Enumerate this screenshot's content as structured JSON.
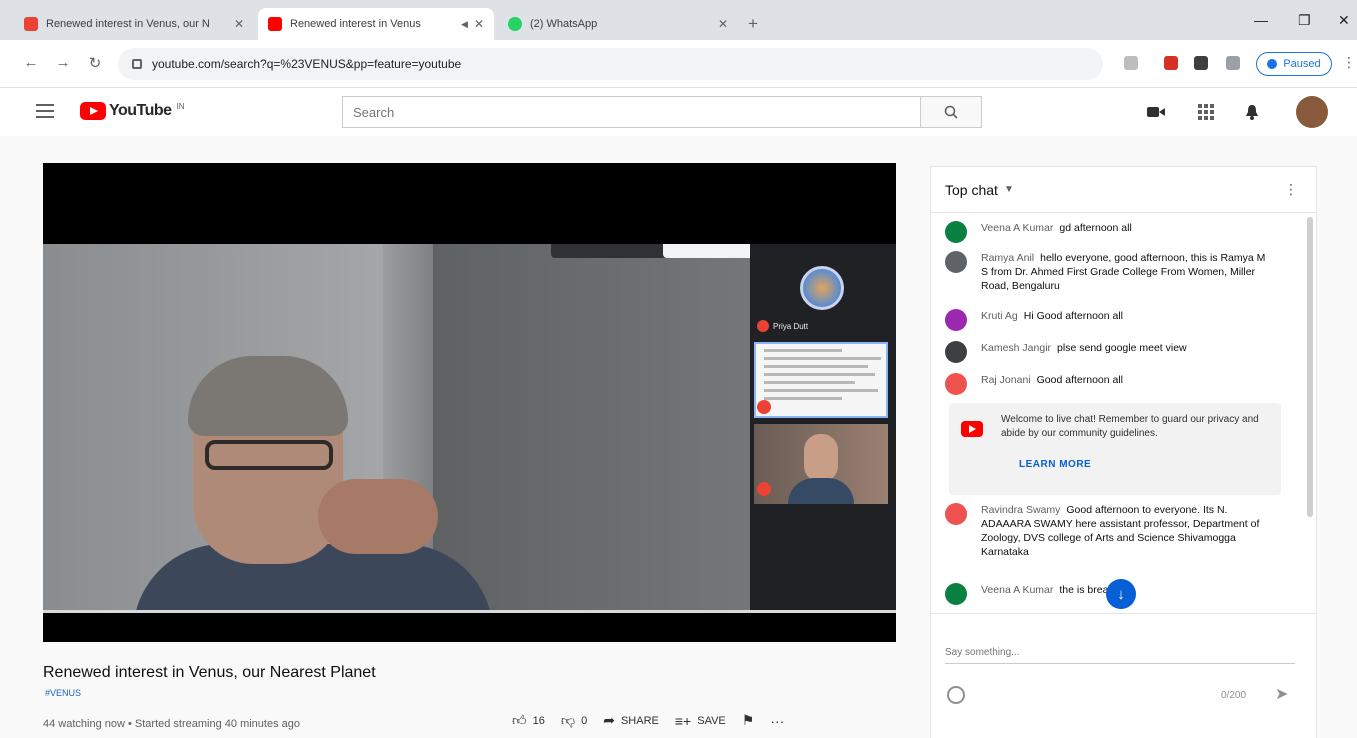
{
  "browser": {
    "tabs": [
      {
        "title": "Renewed interest in Venus, our N",
        "favicon_color": "#ea4335",
        "active": false
      },
      {
        "title": "Renewed interest in Venus",
        "favicon_color": "#ff0000",
        "active": true
      },
      {
        "title": "(2) WhatsApp",
        "favicon_color": "#25d366",
        "active": false
      }
    ],
    "new_tab_icon": "plus-icon",
    "url": "youtube.com/search?q=%23VENUS&pp=feature=youtube",
    "paused_label": "Paused"
  },
  "masthead": {
    "logo_text": "YouTube",
    "region": "IN",
    "search_placeholder": "Search"
  },
  "player": {
    "tile_name": "Priya Dutt",
    "progress": 1.0
  },
  "video": {
    "title": "Renewed interest in Venus, our Nearest Planet",
    "channel_tag": "#VENUS",
    "watch_info": "44 watching now • Started streaming 40 minutes ago",
    "likes": "16",
    "dislikes": "0",
    "share_label": "SHARE",
    "save_label": "SAVE"
  },
  "chat": {
    "header": "Top chat",
    "messages": [
      {
        "author": "Veena A Kumar",
        "text": "gd afternoon all",
        "color": "#0b8043"
      },
      {
        "author": "Ramya Anil",
        "text": "hello everyone, good afternoon, this is Ramya M S from Dr. Ahmed First Grade College From Women, Miller Road, Bengaluru",
        "color": "#5f6368"
      },
      {
        "author": "Kruti Ag",
        "text": "Hi Good afternoon all",
        "color": "#9c27b0"
      },
      {
        "author": "Kamesh Jangir",
        "text": "plse send google meet view",
        "color": "#3c4043"
      },
      {
        "author": "Raj Jonani",
        "text": "Good afternoon all",
        "color": "#ef5350"
      },
      {
        "author": "Ravindra Swamy",
        "text": "Good afternoon  to everyone. Its N. ADAAARA SWAMY here assistant professor, Department of Zoology, DVS college of Arts and Science Shivamogga Karnataka",
        "color": "#ef5350"
      },
      {
        "author": "Veena A Kumar",
        "text": "the  is breaking",
        "color": "#0b8043"
      }
    ],
    "notice_text": "Welcome to live chat! Remember to guard our privacy and abide by our community guidelines.",
    "notice_link": "LEARN MORE",
    "input_placeholder": "Say something...",
    "char_count": "0/200"
  }
}
